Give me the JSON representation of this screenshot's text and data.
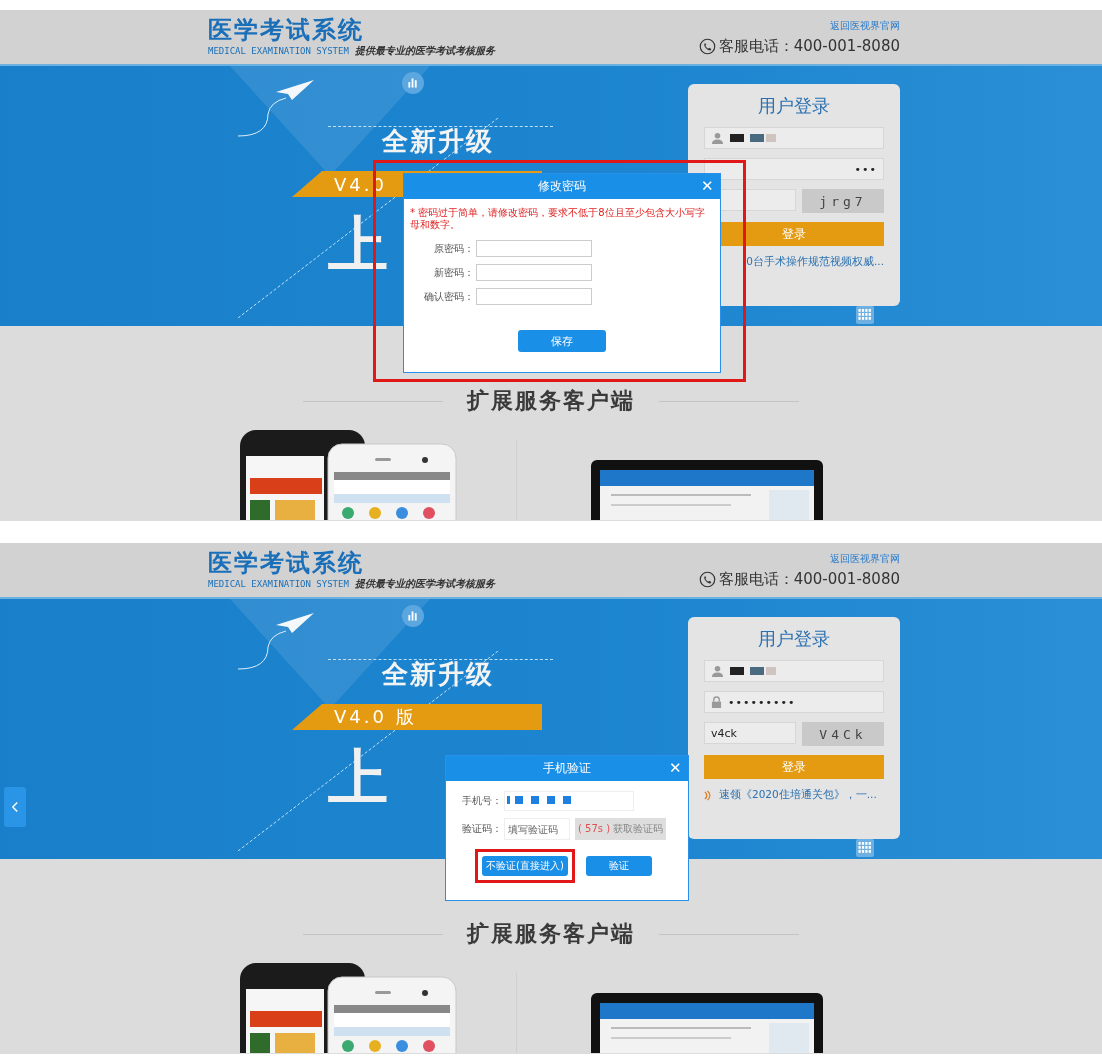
{
  "screens": [
    {
      "header": {
        "logo_title": "医学考试系统",
        "logo_subtitle": "MEDICAL EXAMINATION SYSTEM",
        "slogan": "提供最专业的医学考试考核服务",
        "top_link": "返回医视界官网",
        "hotline": "客服电话：400-001-8080"
      },
      "banner": {
        "headline": "全新升级",
        "version": "V4.0",
        "big_text": "上"
      },
      "login": {
        "title": "用户登录",
        "password": "•••",
        "captcha_image": "jrg7",
        "button": "登录",
        "link": "0台手术操作规范视频权威..."
      },
      "section_title": "扩展服务客户端",
      "side_tab": false,
      "dialog": {
        "kind": "change_password",
        "title": "修改密码",
        "close": "✕",
        "highlighted": true,
        "warning": "* 密码过于简单，请修改密码，要求不低于8位且至少包含大小写字母和数字。",
        "fields": [
          {
            "label": "原密码："
          },
          {
            "label": "新密码："
          },
          {
            "label": "确认密码："
          }
        ],
        "buttons": [
          {
            "label": "保存",
            "highlighted": false
          }
        ]
      }
    },
    {
      "header": {
        "logo_title": "医学考试系统",
        "logo_subtitle": "MEDICAL EXAMINATION SYSTEM",
        "slogan": "提供最专业的医学考试考核服务",
        "top_link": "返回医视界官网",
        "hotline": "客服电话：400-001-8080"
      },
      "banner": {
        "headline": "全新升级",
        "version": "V4.0 版",
        "big_text": "上"
      },
      "login": {
        "title": "用户登录",
        "password": "•••••••••",
        "captcha_value": "v4ck",
        "captcha_image": "V4Ck",
        "button": "登录",
        "link": "速领《2020住培通关包》，一..."
      },
      "section_title": "扩展服务客户端",
      "side_tab": true,
      "dialog": {
        "kind": "phone_verify",
        "title": "手机验证",
        "close": "✕",
        "highlighted": false,
        "phone_label": "手机号：",
        "code_label": "验证码：",
        "code_placeholder": "填写验证码",
        "countdown": "( 57s )",
        "get_code": "获取验证码",
        "buttons": [
          {
            "label": "不验证(直接进入)",
            "highlighted": true
          },
          {
            "label": "验证",
            "highlighted": false
          }
        ]
      }
    }
  ]
}
